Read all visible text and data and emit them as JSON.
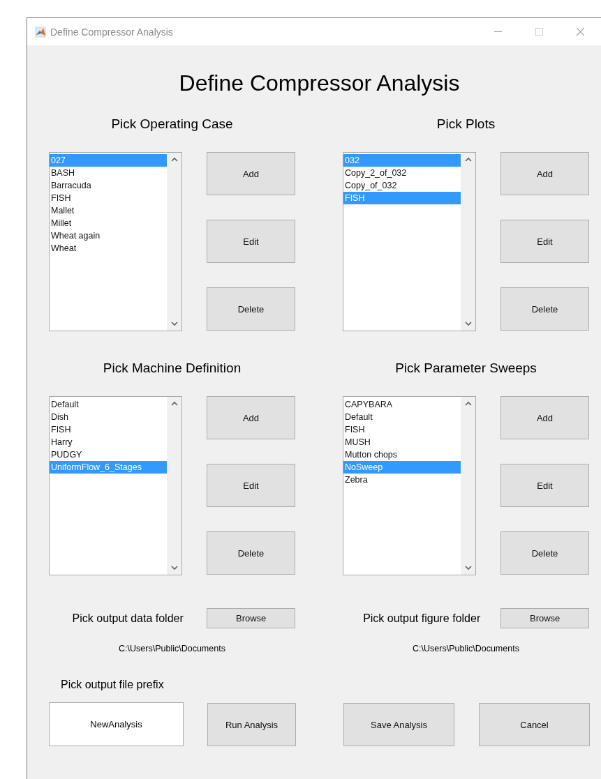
{
  "window": {
    "title": "Define Compressor Analysis",
    "controls": [
      {
        "kind": "minimize",
        "disabled": false
      },
      {
        "kind": "maximize",
        "disabled": true
      },
      {
        "kind": "close",
        "disabled": false
      }
    ]
  },
  "heading": "Define Compressor Analysis",
  "panels": [
    {
      "title": "Pick Operating Case",
      "items": [
        {
          "label": "027",
          "selected": true
        },
        {
          "label": "BASH",
          "selected": false
        },
        {
          "label": "Barracuda",
          "selected": false
        },
        {
          "label": "FISH",
          "selected": false
        },
        {
          "label": "Mallet",
          "selected": false
        },
        {
          "label": "Millet",
          "selected": false
        },
        {
          "label": "Wheat again",
          "selected": false
        },
        {
          "label": "Wheat",
          "selected": false
        }
      ],
      "buttons": [
        "Add",
        "Edit",
        "Delete"
      ]
    },
    {
      "title": "Pick Plots",
      "items": [
        {
          "label": "032",
          "selected": true
        },
        {
          "label": "Copy_2_of_032",
          "selected": false
        },
        {
          "label": "Copy_of_032",
          "selected": false
        },
        {
          "label": "FISH",
          "selected": true
        }
      ],
      "buttons": [
        "Add",
        "Edit",
        "Delete"
      ]
    },
    {
      "title": "Pick Machine Definition",
      "items": [
        {
          "label": "Default",
          "selected": false
        },
        {
          "label": "Dish",
          "selected": false
        },
        {
          "label": "FISH",
          "selected": false
        },
        {
          "label": "Harry",
          "selected": false
        },
        {
          "label": "PUDGY",
          "selected": false
        },
        {
          "label": "UniformFlow_6_Stages",
          "selected": true
        }
      ],
      "buttons": [
        "Add",
        "Edit",
        "Delete"
      ]
    },
    {
      "title": "Pick Parameter Sweeps",
      "items": [
        {
          "label": "CAPYBARA",
          "selected": false
        },
        {
          "label": "Default",
          "selected": false
        },
        {
          "label": "FISH",
          "selected": false
        },
        {
          "label": "MUSH",
          "selected": false
        },
        {
          "label": "Mutton chops",
          "selected": false
        },
        {
          "label": "NoSweep",
          "selected": true
        },
        {
          "label": "Zebra",
          "selected": false
        }
      ],
      "buttons": [
        "Add",
        "Edit",
        "Delete"
      ]
    }
  ],
  "folders": [
    {
      "label": "Pick output data folder",
      "button": "Browse",
      "path": "C:\\Users\\Public\\Documents"
    },
    {
      "label": "Pick output figure folder",
      "button": "Browse",
      "path": "C:\\Users\\Public\\Documents"
    }
  ],
  "prefix": {
    "label": "Pick output file prefix",
    "value": "NewAnalysis"
  },
  "actions": [
    "Run Analysis",
    "Save Analysis",
    "Cancel"
  ]
}
